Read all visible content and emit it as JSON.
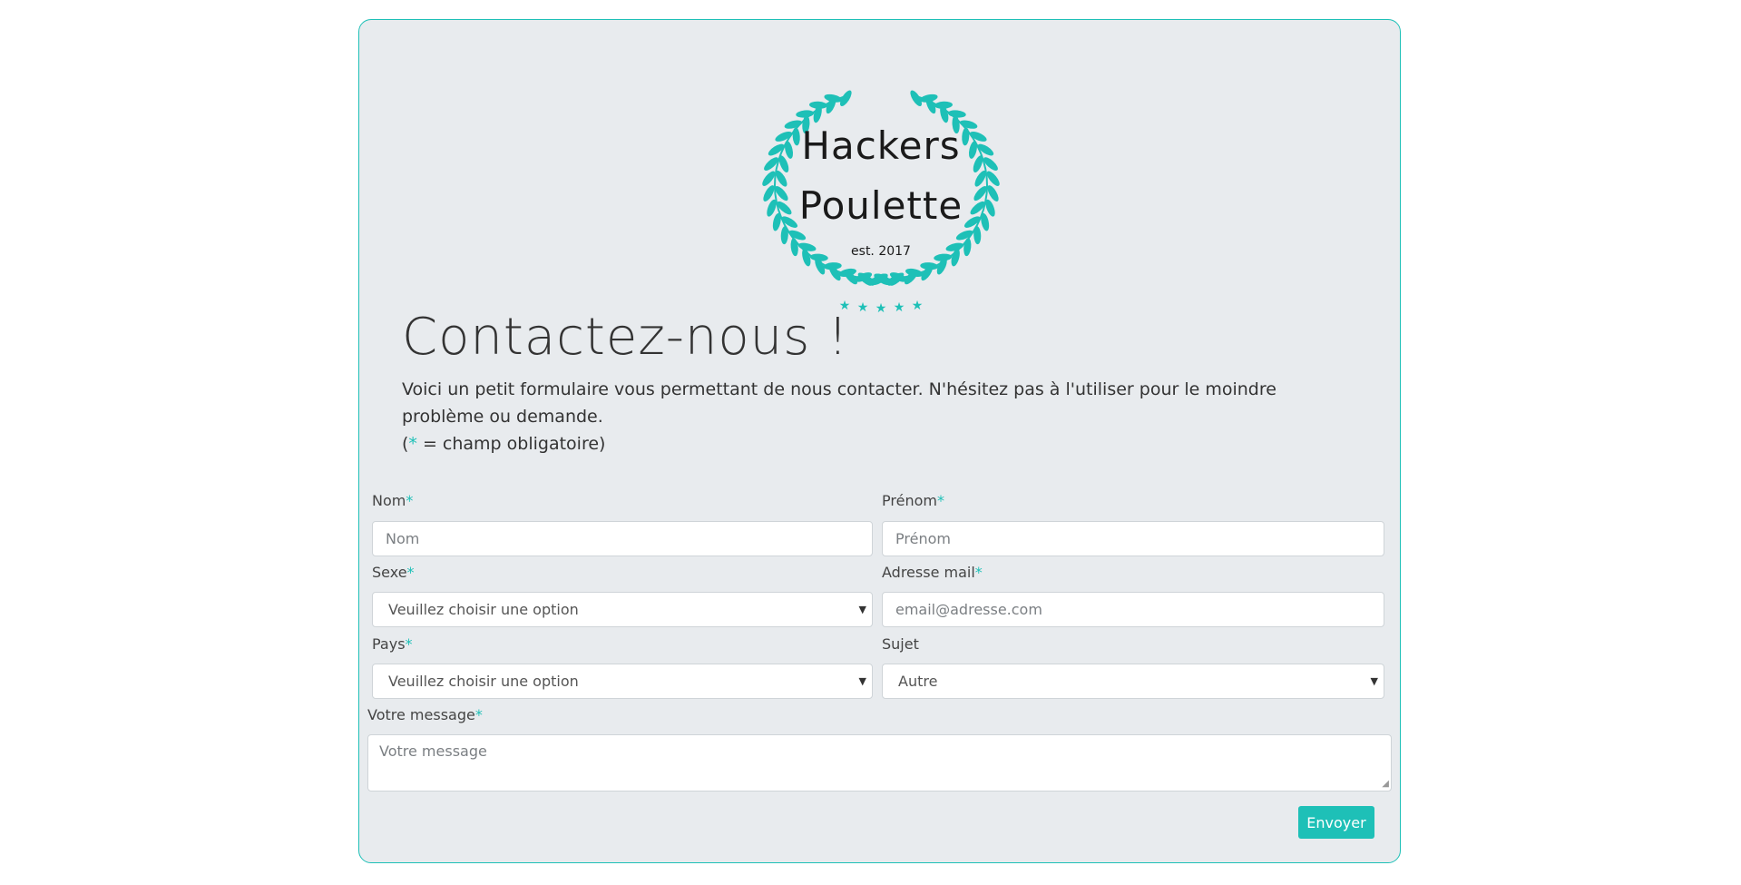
{
  "logo": {
    "line1": "Hackers",
    "line2": "Poulette",
    "line3": "est. 2017",
    "color": "#1ec0b7"
  },
  "header": {
    "title": "Contactez-nous !",
    "intro": "Voici un petit formulaire vous permettant de nous contacter. N'hésitez pas à l'utiliser pour le moindre problème ou demande.",
    "note_open": "(",
    "note_star": "*",
    "note_close": " = champ obligatoire)"
  },
  "form": {
    "required_mark": "*",
    "nom": {
      "label": "Nom",
      "placeholder": "Nom"
    },
    "prenom": {
      "label": "Prénom",
      "placeholder": "Prénom"
    },
    "sexe": {
      "label": "Sexe",
      "value": "Veuillez choisir une option"
    },
    "email": {
      "label": "Adresse mail",
      "placeholder": "email@adresse.com"
    },
    "pays": {
      "label": "Pays",
      "value": "Veuillez choisir une option"
    },
    "sujet": {
      "label": "Sujet",
      "value": "Autre"
    },
    "message": {
      "label": "Votre message",
      "placeholder": "Votre message"
    },
    "submit_label": "Envoyer"
  },
  "colors": {
    "accent": "#1ec0b7",
    "card_background": "#e8ebee"
  }
}
